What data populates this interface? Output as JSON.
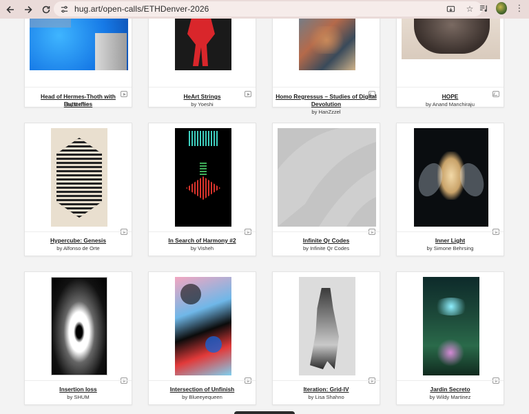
{
  "browser": {
    "url": "hug.art/open-calls/ETHDenver-2026"
  },
  "icons": {
    "back": "arrow-left-icon",
    "forward": "arrow-right-icon",
    "reload": "reload-icon",
    "site_info": "tune-icon",
    "install": "install-icon",
    "bookmark": "star-icon",
    "media": "media-queue-icon",
    "play": "play-icon",
    "image": "image-icon"
  },
  "artworks": [
    {
      "title": "Head of Hermes-Thoth with Butterflies",
      "author": "by Garen",
      "media": "play"
    },
    {
      "title": "HeArt Strings",
      "author": "by Yoeshi",
      "media": "play"
    },
    {
      "title": "Homo Regressus – Studies of Digital Devolution",
      "author": "by HanZzzel",
      "media": "image"
    },
    {
      "title": "HOPE",
      "author": "by Anand Manchiraju",
      "media": "image"
    },
    {
      "title": "Hypercube: Genesis",
      "author": "by Alfonso de Orte",
      "media": "play"
    },
    {
      "title": "In Search of Harmony #2",
      "author": "by Visheh",
      "media": "play"
    },
    {
      "title": "Infinite Qr Codes",
      "author": "by Infinite Qr Codes",
      "media": "play"
    },
    {
      "title": "Inner Light",
      "author": "by Simone Behrsing",
      "media": "play"
    },
    {
      "title": "Insertion loss",
      "author": "by SHUM",
      "media": "play"
    },
    {
      "title": "Intersection of Unfinish",
      "author": "by Blueeyequeen",
      "media": "play"
    },
    {
      "title": "Iteration: Grid-IV",
      "author": "by Lisa Shahno",
      "media": "play"
    },
    {
      "title": "Jardin Secreto",
      "author": "by Wildy Martinez",
      "media": "play"
    }
  ]
}
